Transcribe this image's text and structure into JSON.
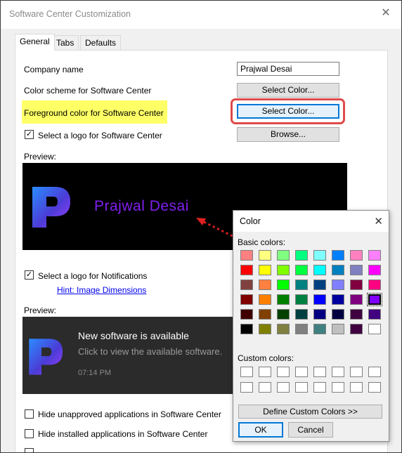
{
  "window": {
    "title": "Software Center Customization"
  },
  "tabs": [
    "General",
    "Tabs",
    "Defaults"
  ],
  "general": {
    "company_name_label": "Company name",
    "company_name_value": "Prajwal Desai",
    "color_scheme_label": "Color scheme for Software Center",
    "color_scheme_button": "Select Color...",
    "foreground_label": "Foreground color for Software Center",
    "foreground_button": "Select Color...",
    "logo_checkbox_label": "Select a logo for Software Center",
    "logo_checked": true,
    "browse_button": "Browse...",
    "preview_label": "Preview:",
    "preview_company_text": "Prajwal Desai",
    "notif_checkbox_label": "Select a logo for Notifications",
    "notif_checked": true,
    "hint_link": "Hint: Image Dimensions",
    "preview2_label": "Preview:",
    "notif_title": "New software is available",
    "notif_sub": "Click to view the available software.",
    "notif_time": "07:14 PM",
    "hide_unapproved_label": "Hide unapproved applications in Software Center",
    "hide_installed_label": "Hide installed applications in Software Center"
  },
  "color_dialog": {
    "title": "Color",
    "basic_label": "Basic colors:",
    "custom_label": "Custom colors:",
    "define_button": "Define Custom Colors >>",
    "ok_button": "OK",
    "cancel_button": "Cancel",
    "basic_colors": [
      "#ff8080",
      "#ffff80",
      "#80ff80",
      "#00ff80",
      "#80ffff",
      "#0080ff",
      "#ff80c0",
      "#ff80ff",
      "#ff0000",
      "#ffff00",
      "#80ff00",
      "#00ff40",
      "#00ffff",
      "#0080c0",
      "#8080c0",
      "#ff00ff",
      "#804040",
      "#ff8040",
      "#00ff00",
      "#008080",
      "#004080",
      "#8080ff",
      "#800040",
      "#ff0080",
      "#800000",
      "#ff8000",
      "#008000",
      "#008040",
      "#0000ff",
      "#0000a0",
      "#800080",
      "#8000ff",
      "#400000",
      "#804000",
      "#004000",
      "#004040",
      "#000080",
      "#000040",
      "#400040",
      "#400080",
      "#000000",
      "#808000",
      "#808040",
      "#808080",
      "#408080",
      "#c0c0c0",
      "#400040",
      "#ffffff"
    ],
    "selected_color": "#8000ff"
  },
  "accent": "#8000ff"
}
